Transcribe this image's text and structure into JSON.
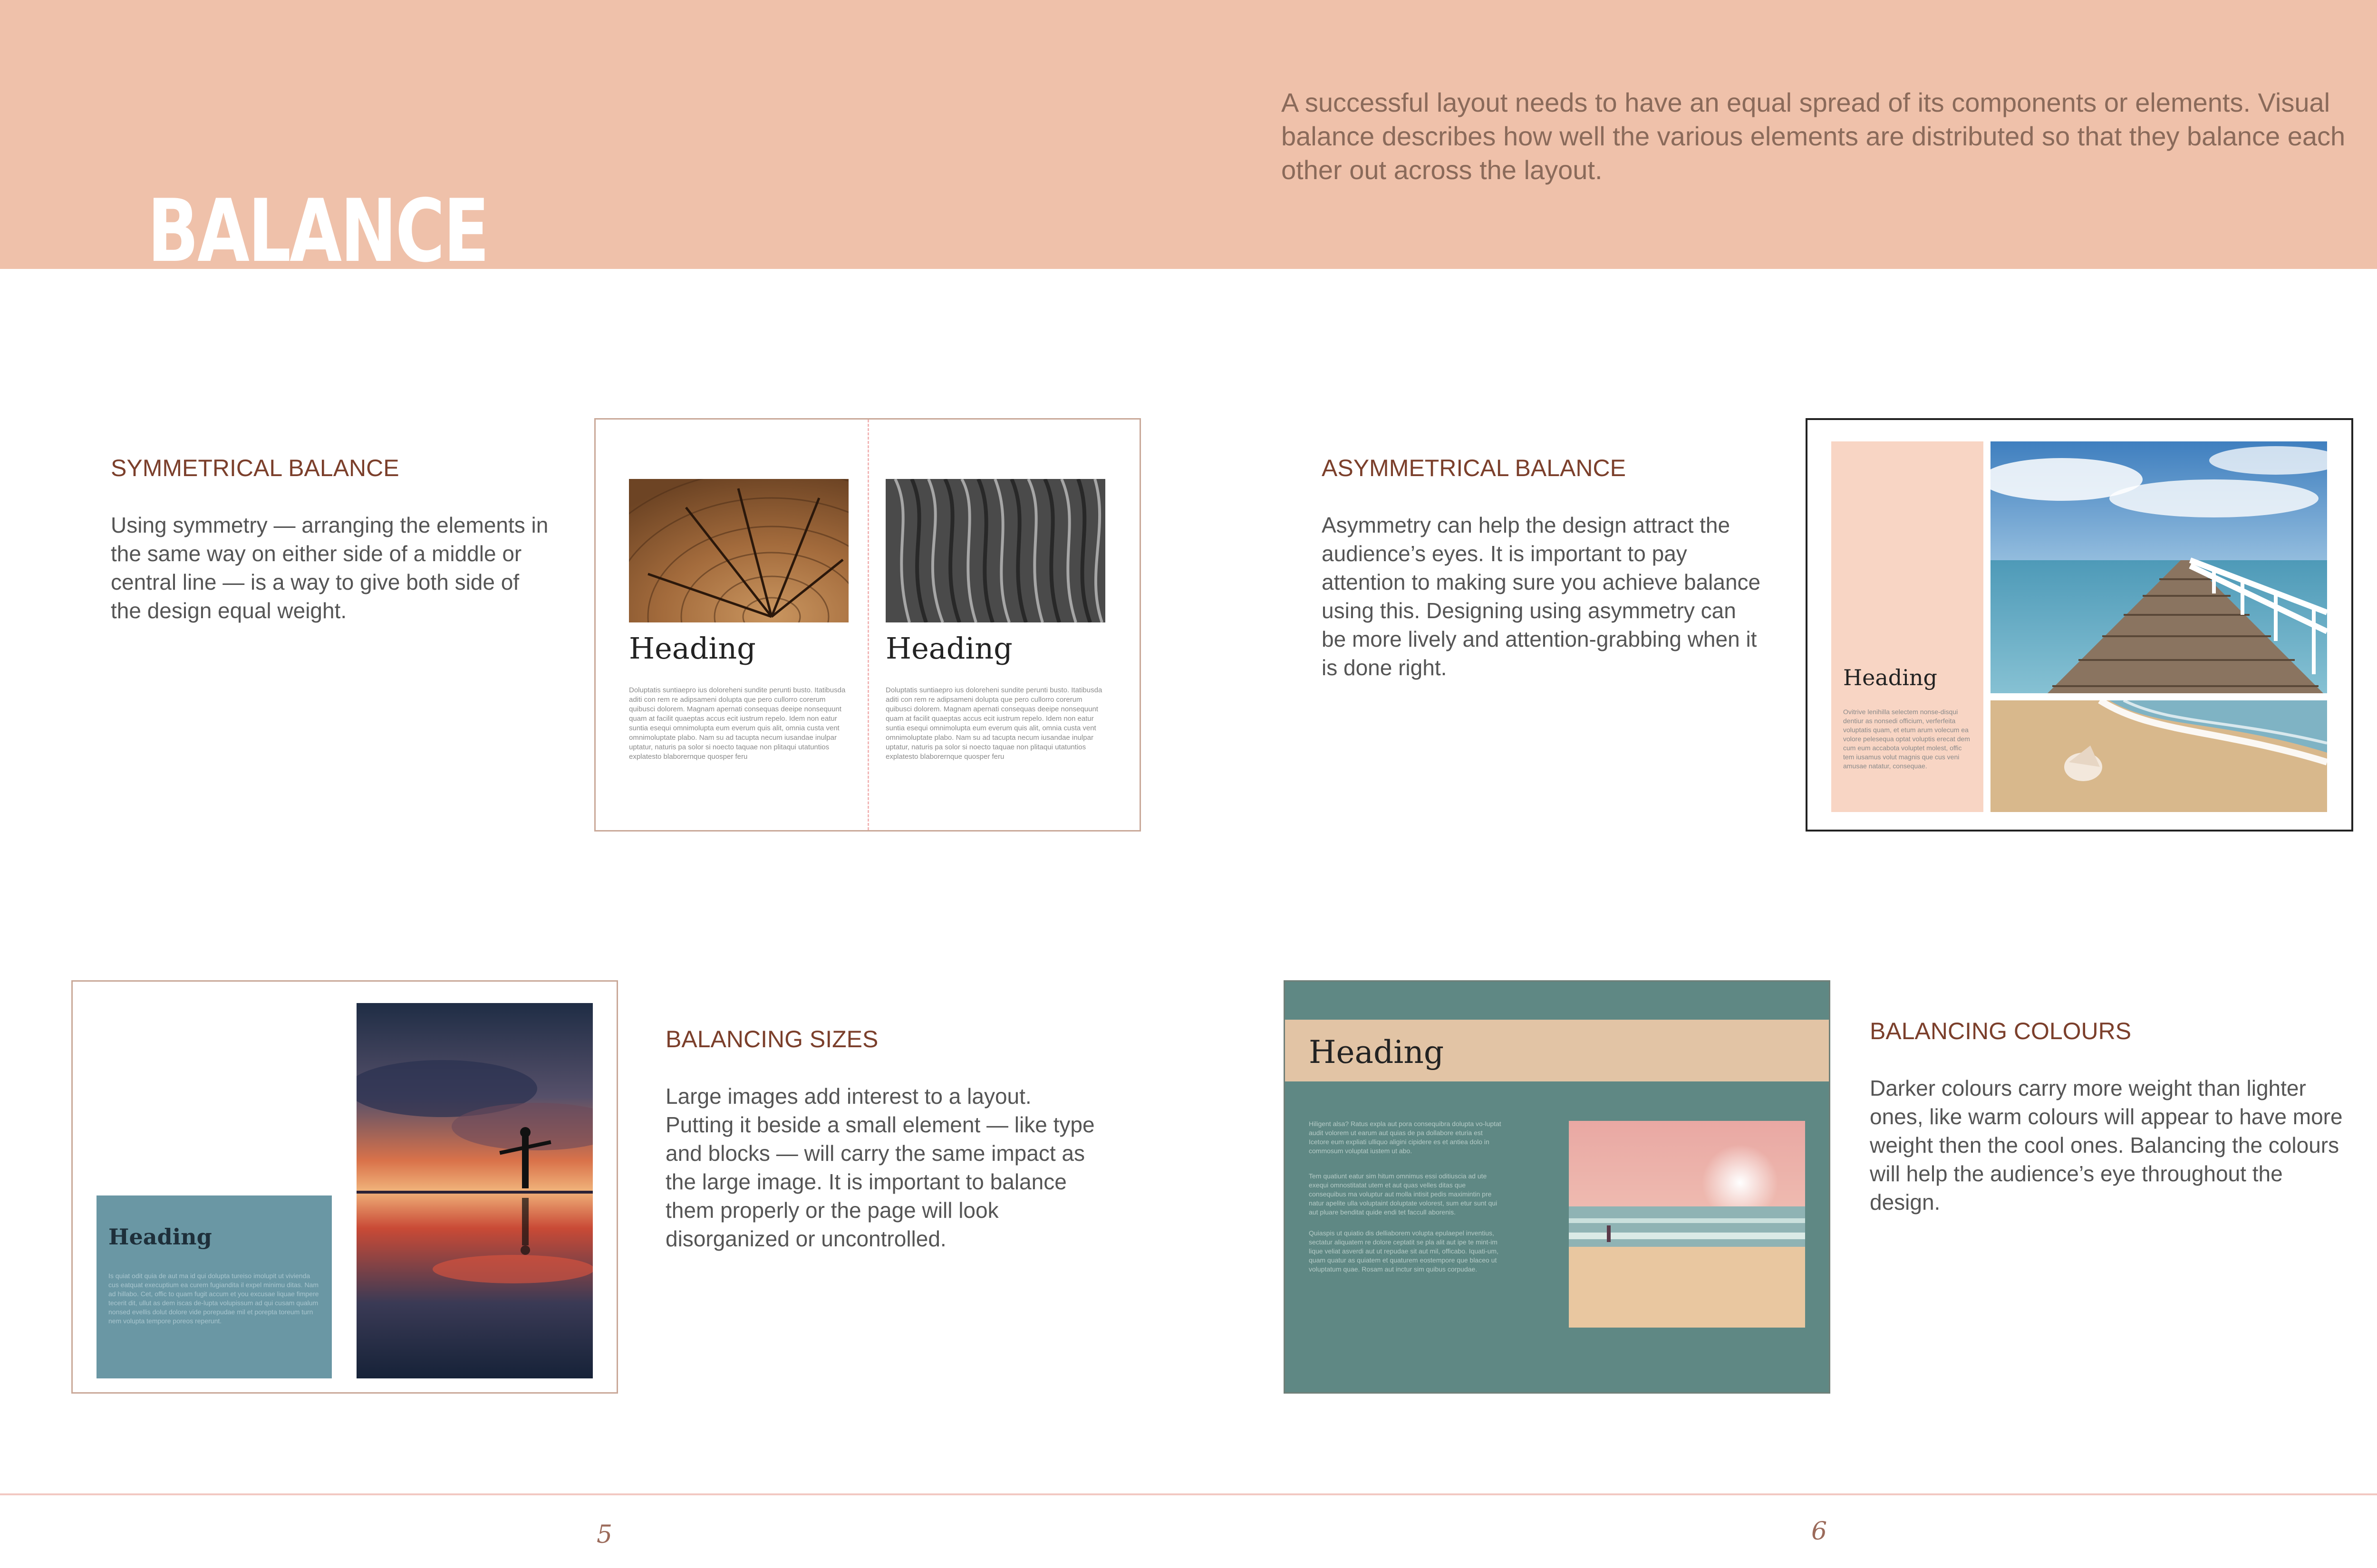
{
  "header": {
    "title": "BALANCE",
    "intro": "A successful layout needs to have an equal spread of its components or elements. Visual balance describes how well the various elements are distributed so that they balance each other out across the layout."
  },
  "sections": {
    "symmetrical": {
      "title": "SYMMETRICAL BALANCE",
      "body": "Using symmetry — arranging the elements in the same way on either side of a middle or central line — is a way to give both side of the design equal weight."
    },
    "asymmetrical": {
      "title": "ASYMMETRICAL BALANCE",
      "body": "Asymmetry can help the design attract the audience’s eyes. It is important to pay attention to making sure you achieve balance using this. Designing using asymmetry can be more lively and attention-grabbing when it is done right."
    },
    "sizes": {
      "title": "BALANCING SIZES",
      "body": "Large images add interest to a layout. Putting it beside a small element — like type and blocks — will carry the same impact as the large image. It is important to balance them properly or the page will look disorganized or uncontrolled."
    },
    "colours": {
      "title": "BALANCING COLOURS",
      "body": "Darker colours carry more weight than lighter ones, like warm colours will appear  to have more weight then the cool ones. Balancing the colours will help the audience’s eye throughout the design."
    }
  },
  "examples": {
    "symmetrical": {
      "left_heading": "Heading",
      "left_text": "Doluptatis suntiaepro ius doloreheni sundite perunti busto. Itatibusda aditi con rem re adipsameni dolupta que pero cullorro corerum quibusci dolorem. Magnam apernati consequas deeipe nonsequunt quam at facilit quaeptas accus ecit iustrum repelo. Idem non eatur suntia esequi omnimolupta eum everum quis alit, omnia custa vent omnimoluptate plabo. Nam su ad tacupta necum iusandae inulpar uptatur, naturis pa solor si noecto taquae non plitaqui utatuntios explatesto blaborernque quosper feru",
      "right_heading": "Heading",
      "right_text": "Doluptatis suntiaepro ius doloreheni sundite perunti busto. Itatibusda aditi con rem re adipsameni dolupta que pero cullorro corerum quibusci dolorem. Magnam apernati consequas deeipe nonsequunt quam at facilit quaeptas accus ecit iustrum repelo. Idem non eatur suntia esequi omnimolupta eum everum quis alit, omnia custa vent omnimoluptate plabo. Nam su ad tacupta necum iusandae inulpar uptatur, naturis pa solor si noecto taquae non plitaqui utatuntios explatesto blaborernque quosper feru"
    },
    "asymmetrical": {
      "heading": "Heading",
      "text": "Ovitrive lenihilla selectem nonse-disqui dentiur as nonsedi officium, verferfeita voluptatis quam, et etum arum volecum ea volore pelesequa optat voluptis erecat dem cum eum accabota voluptet molest, offic tem iusamus volut magnis que cus veni amusae natatur, consequae."
    },
    "sizes": {
      "heading": "Heading",
      "text": "Is quiat odit quia de aut ma id qui dolupta tureiso imolupit ut vivienda cus eatquat execuptium ea curem fugiandita il expel minimu ditas. Nam ad hillabo. Cet, offic to quam fugit accum et you excusae liquae fimpere tecerit dit, ullut as dem iscas de-lupta volupissum ad qui cusam qualum nonsed evellis dolut dolore vide porepudae mil et porepta toreum turn nem volupta tempore poreos reperunt."
    },
    "colours": {
      "heading": "Heading",
      "para1": "Hiligent alsa? Ratus expla aut pora consequibra dolupta vo-luptat audit volorem ut earum aut quias de pa dollabore eturia est Icetore eum expliati ulliquo aligini cipidere es et antiea dolo in commosum voluptat iustem ut abo.",
      "para2": "Tem quatiunt eatur sim hitum omnimus essi oditiuscia ad ute exequi omnostitatat utem et aut quas velles ditas que consequibus ma voluptur aut molla intisit pedis maximintin pre natur apelite ulla voluptaint doluptate volorest, sum etur sunt qui aut pluare benditat quide endi tet faccull aborenis.",
      "para3": "Quiaspis ut quiatio dis delliaborem volupta epulaepel inventius, sectatur aliquatem re dolore ceptatit se pla alit aut ipe te mint-im lique veliat asverdi aut ut repudae sit aut mil, officabo. Iquati-um, quam quatur as quiatem et quaturem eostempore que blaceo ut voluptatum quae. Rosam aut inctur sim quibus corpudae."
    }
  },
  "footer": {
    "page_left": "5",
    "page_right": "6"
  },
  "colors": {
    "header_band": "#efc1aa",
    "section_title": "#7b3f2b",
    "frame_border": "#c9a898",
    "asym_block": "#f8d5c4",
    "sizes_block": "#6a97a4",
    "colours_panel": "#5f8884",
    "colours_band": "#e2c4a5"
  }
}
